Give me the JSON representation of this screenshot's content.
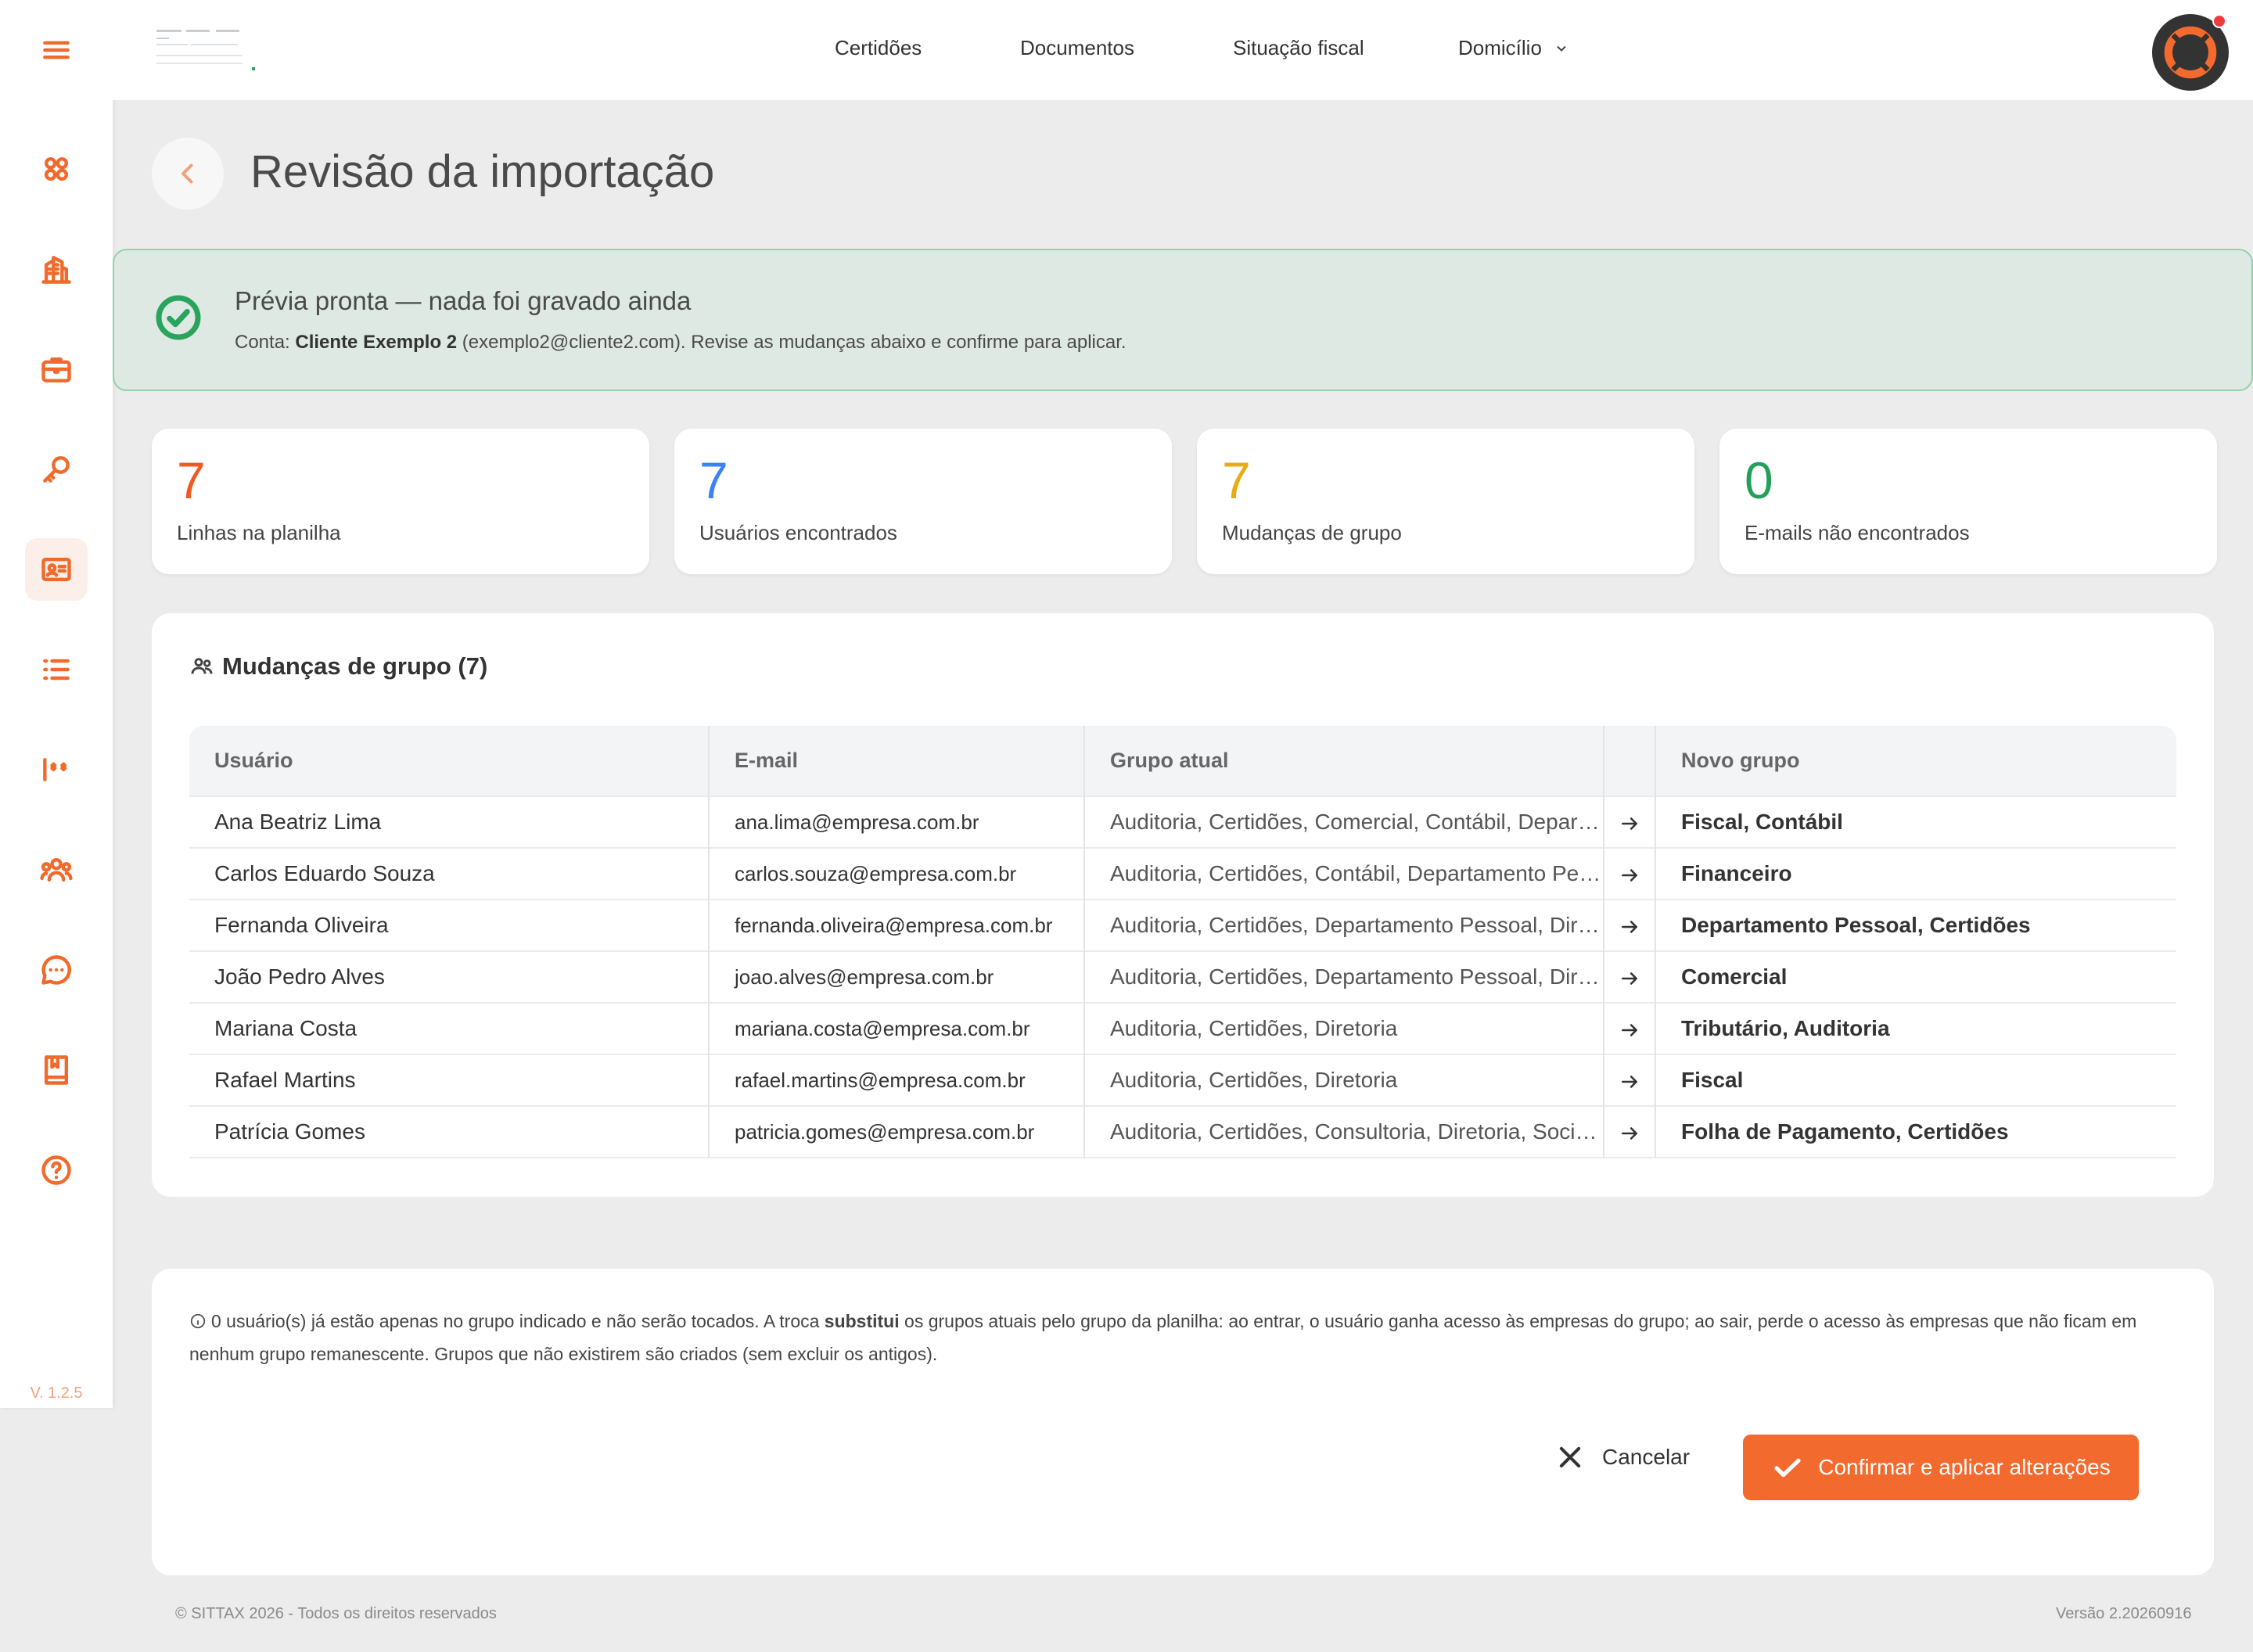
{
  "sidebar": {
    "version": "V. 1.2.5",
    "icons": [
      "menu-icon",
      "apps-icon",
      "building-icon",
      "briefcase-icon",
      "key-icon",
      "id-card-icon",
      "list-icon",
      "password-icon",
      "users-icon",
      "chat-icon",
      "book-icon",
      "help-icon"
    ],
    "active": "id-card-icon",
    "accent_color": "#f06a2c"
  },
  "topbar": {
    "nav": [
      "Certidões",
      "Documentos",
      "Situação fiscal",
      "Domicílio"
    ],
    "has_notification": true
  },
  "page": {
    "title": "Revisão da importação"
  },
  "alert": {
    "title": "Prévia pronta — nada foi gravado ainda",
    "account_prefix": "Conta: ",
    "account_name": "Cliente Exemplo 2",
    "account_rest": " (exemplo2@cliente2.com). Revise as mudanças abaixo e confirme para aplicar.",
    "color": "#28a45d"
  },
  "stats": [
    {
      "value": "7",
      "label": "Linhas na planilha",
      "color": "#ef5a24"
    },
    {
      "value": "7",
      "label": "Usuários encontrados",
      "color": "#3b82f6"
    },
    {
      "value": "7",
      "label": "Mudanças de grupo",
      "color": "#e6ac12"
    },
    {
      "value": "0",
      "label": "E-mails não encontrados",
      "color": "#22a05a"
    }
  ],
  "changes": {
    "title": "Mudanças de grupo (7)",
    "columns": [
      "Usuário",
      "E-mail",
      "Grupo atual",
      "",
      "Novo grupo"
    ],
    "rows": [
      {
        "user": "Ana Beatriz Lima",
        "email": "ana.lima@empresa.com.br",
        "current": "Auditoria, Certidões, Comercial, Contábil, Departamento Pessoal",
        "new": "Fiscal, Contábil"
      },
      {
        "user": "Carlos Eduardo Souza",
        "email": "carlos.souza@empresa.com.br",
        "current": "Auditoria, Certidões, Contábil, Departamento Pessoal",
        "new": "Financeiro"
      },
      {
        "user": "Fernanda Oliveira",
        "email": "fernanda.oliveira@empresa.com.br",
        "current": "Auditoria, Certidões, Departamento Pessoal, Diretoria",
        "new": "Departamento Pessoal, Certidões"
      },
      {
        "user": "João Pedro Alves",
        "email": "joao.alves@empresa.com.br",
        "current": "Auditoria, Certidões, Departamento Pessoal, Diretoria",
        "new": "Comercial"
      },
      {
        "user": "Mariana Costa",
        "email": "mariana.costa@empresa.com.br",
        "current": "Auditoria, Certidões, Diretoria",
        "new": "Tributário, Auditoria"
      },
      {
        "user": "Rafael Martins",
        "email": "rafael.martins@empresa.com.br",
        "current": "Auditoria, Certidões, Diretoria",
        "new": "Fiscal"
      },
      {
        "user": "Patrícia Gomes",
        "email": "patricia.gomes@empresa.com.br",
        "current": "Auditoria, Certidões, Consultoria, Diretoria, Societário",
        "new": "Folha de Pagamento, Certidões"
      }
    ]
  },
  "info": {
    "text_before": "0 usuário(s) já estão apenas no grupo indicado e não serão tocados. A troca ",
    "text_bold": "substitui",
    "text_after": " os grupos atuais pelo grupo da planilha: ao entrar, o usuário ganha acesso às empresas do grupo; ao sair, perde o acesso às empresas que não ficam em nenhum grupo remanescente. Grupos que não existirem são criados (sem excluir os antigos).",
    "cancel_label": "Cancelar",
    "confirm_label": "Confirmar e aplicar alterações",
    "confirm_color": "#f26a2e"
  },
  "footer": {
    "copyright": "© SITTAX 2026 - Todos os direitos reservados",
    "version": "Versão 2.20260916"
  }
}
